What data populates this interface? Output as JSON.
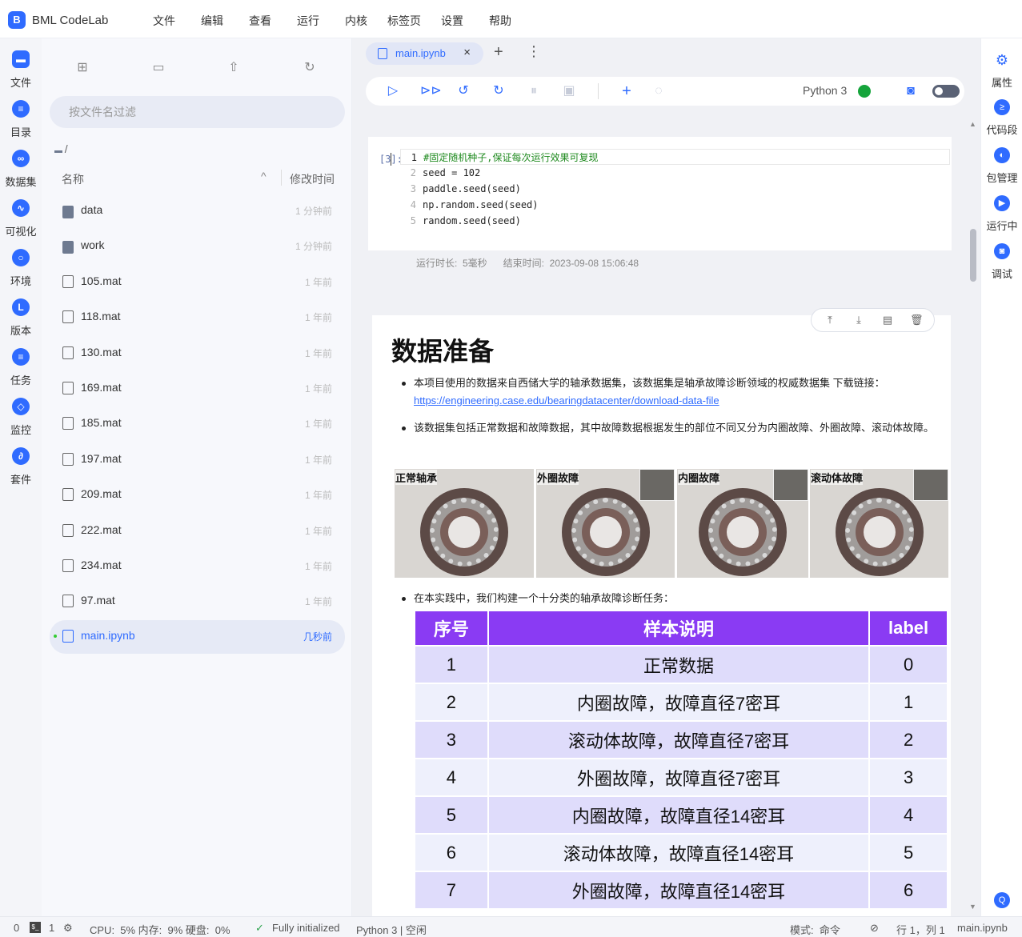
{
  "app": {
    "logo_text": "BML CodeLab",
    "brand_color": "#2f6bff"
  },
  "menu": [
    "文件",
    "编辑",
    "查看",
    "运行",
    "内核",
    "标签页",
    "设置",
    "帮助"
  ],
  "left_rail": [
    {
      "label": "文件",
      "icon": "folder-icon"
    },
    {
      "label": "目录",
      "icon": "toc-icon"
    },
    {
      "label": "数据集",
      "icon": "dataset-icon"
    },
    {
      "label": "可视化",
      "icon": "chart-icon"
    },
    {
      "label": "环境",
      "icon": "environment-icon"
    },
    {
      "label": "版本",
      "icon": "version-icon"
    },
    {
      "label": "任务",
      "icon": "task-icon"
    },
    {
      "label": "监控",
      "icon": "monitor-icon"
    },
    {
      "label": "套件",
      "icon": "suite-icon"
    }
  ],
  "files": {
    "filter_placeholder": "按文件名过滤",
    "path": "/",
    "col_name": "名称",
    "col_time": "修改时间",
    "items": [
      {
        "name": "data",
        "time": "1 分钟前",
        "type": "folder"
      },
      {
        "name": "work",
        "time": "1 分钟前",
        "type": "folder"
      },
      {
        "name": "105.mat",
        "time": "1 年前",
        "type": "file"
      },
      {
        "name": "118.mat",
        "time": "1 年前",
        "type": "file"
      },
      {
        "name": "130.mat",
        "time": "1 年前",
        "type": "file"
      },
      {
        "name": "169.mat",
        "time": "1 年前",
        "type": "file"
      },
      {
        "name": "185.mat",
        "time": "1 年前",
        "type": "file"
      },
      {
        "name": "197.mat",
        "time": "1 年前",
        "type": "file"
      },
      {
        "name": "209.mat",
        "time": "1 年前",
        "type": "file"
      },
      {
        "name": "222.mat",
        "time": "1 年前",
        "type": "file"
      },
      {
        "name": "234.mat",
        "time": "1 年前",
        "type": "file"
      },
      {
        "name": "97.mat",
        "time": "1 年前",
        "type": "file"
      },
      {
        "name": "main.ipynb",
        "time": "几秒前",
        "type": "notebook"
      }
    ]
  },
  "editor": {
    "tab_label": "main.ipynb",
    "kernel_name": "Python 3",
    "kernel_status_color": "#15a43b",
    "cell1": {
      "prompt": "[3]:",
      "lines": [
        {
          "num": "1",
          "text": "#固定随机种子,保证每次运行效果可复现"
        },
        {
          "num": "2",
          "text": "seed = 102"
        },
        {
          "num": "3",
          "text": "paddle.seed(seed)"
        },
        {
          "num": "4",
          "text": "np.random.seed(seed)"
        },
        {
          "num": "5",
          "text": "random.seed(seed)"
        }
      ],
      "run_info": "运行时长:  5毫秒      结束时间:  2023-09-08 15:06:48"
    },
    "cell2": {
      "heading": "数据准备",
      "bullet1_text": "本项目使用的数据来自西储大学的轴承数据集，该数据集是轴承故障诊断领域的权威数据集 下载链接：",
      "bullet1_link": "https://engineering.case.edu/bearingdatacenter/download-data-file",
      "bullet2_text": "该数据集包括正常数据和故障数据，其中故障数据根据发生的部位不同又分为内圈故障、外圈故障、滚动体故障。",
      "image_labels": [
        "正常轴承",
        "外圈故障",
        "内圈故障",
        "滚动体故障"
      ],
      "bullet3_text": "在本实践中，我们构建一个十分类的轴承故障诊断任务：",
      "table_headers": [
        "序号",
        "样本说明",
        "label"
      ],
      "table_rows": [
        [
          "1",
          "正常数据",
          "0"
        ],
        [
          "2",
          "内圈故障，故障直径7密耳",
          "1"
        ],
        [
          "3",
          "滚动体故障，故障直径7密耳",
          "2"
        ],
        [
          "4",
          "外圈故障，故障直径7密耳",
          "3"
        ],
        [
          "5",
          "内圈故障，故障直径14密耳",
          "4"
        ],
        [
          "6",
          "滚动体故障，故障直径14密耳",
          "5"
        ],
        [
          "7",
          "外圈故障，故障直径14密耳",
          "6"
        ]
      ]
    }
  },
  "right_rail": [
    {
      "label": "属性",
      "icon": "gear-icon"
    },
    {
      "label": "代码段",
      "icon": "snippet-icon"
    },
    {
      "label": "包管理",
      "icon": "package-icon"
    },
    {
      "label": "运行中",
      "icon": "running-icon"
    },
    {
      "label": "调试",
      "icon": "debug-icon"
    }
  ],
  "status": {
    "count_a": "0",
    "count_b": "1",
    "resources": "CPU:  5% 内存:  9% 硬盘:  0%",
    "init_text": "Fully initialized",
    "kernel_state": "Python 3 | 空闲",
    "mode": "模式:  命令",
    "position": "行 1，列 1",
    "file": "main.ipynb"
  }
}
